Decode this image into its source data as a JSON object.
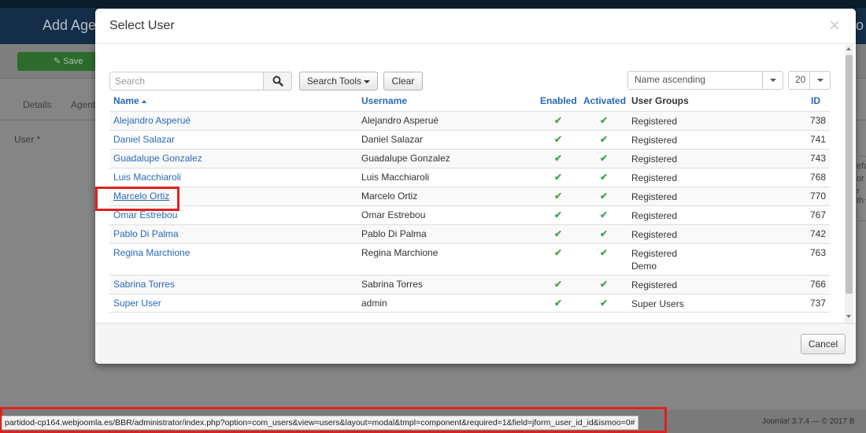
{
  "background": {
    "page_title": "Add Age",
    "page_title_right": "o",
    "save_label": "Save",
    "tabs": [
      "Details",
      "Agent"
    ],
    "user_label": "User *",
    "side_fragments": [
      "efa",
      "or",
      "r th"
    ],
    "footer_text": "Joomla! 3.7.4 — © 2017 B"
  },
  "modal": {
    "title": "Select User",
    "close_glyph": "×",
    "search": {
      "placeholder": "Search",
      "value": ""
    },
    "search_tools_label": "Search Tools",
    "clear_label": "Clear",
    "sort_select": "Name ascending",
    "limit_select": "20",
    "columns": {
      "name": "Name",
      "username": "Username",
      "enabled": "Enabled",
      "activated": "Activated",
      "groups": "User Groups",
      "id": "ID"
    },
    "rows": [
      {
        "name": "Alejandro Asperué",
        "username": "Alejandro Asperué",
        "enabled": "✔",
        "activated": "✔",
        "groups": "Registered",
        "id": "738"
      },
      {
        "name": "Daniel Salazar",
        "username": "Daniel Salazar",
        "enabled": "✔",
        "activated": "✔",
        "groups": "Registered",
        "id": "741"
      },
      {
        "name": "Guadalupe Gonzalez",
        "username": "Guadalupe Gonzalez",
        "enabled": "✔",
        "activated": "✔",
        "groups": "Registered",
        "id": "743"
      },
      {
        "name": "Luis Macchiaroli",
        "username": "Luis Macchiaroli",
        "enabled": "✔",
        "activated": "✔",
        "groups": "Registered",
        "id": "768"
      },
      {
        "name": "Marcelo Ortiz",
        "username": "Marcelo Ortiz",
        "enabled": "✔",
        "activated": "✔",
        "groups": "Registered",
        "id": "770"
      },
      {
        "name": "Omar Estrebou",
        "username": "Omar Estrebou",
        "enabled": "✔",
        "activated": "✔",
        "groups": "Registered",
        "id": "767"
      },
      {
        "name": "Pablo Di Palma",
        "username": "Pablo Di Palma",
        "enabled": "✔",
        "activated": "✔",
        "groups": "Registered",
        "id": "742"
      },
      {
        "name": "Regina Marchione",
        "username": "Regina Marchione",
        "enabled": "✔",
        "activated": "✔",
        "groups": "Registered",
        "groups2": "Demo",
        "id": "763"
      },
      {
        "name": "Sabrina Torres",
        "username": "Sabrina Torres",
        "enabled": "✔",
        "activated": "✔",
        "groups": "Registered",
        "id": "766"
      },
      {
        "name": "Super User",
        "username": "admin",
        "enabled": "✔",
        "activated": "✔",
        "groups": "Super Users",
        "id": "737"
      }
    ],
    "cancel_label": "Cancel"
  },
  "status_bar": {
    "url": "partidod-cp164.webjoomla.es/BBR/administrator/index.php?option=com_users&view=users&layout=modal&tmpl=component&required=1&field=jform_user_id_id&ismoo=0#"
  },
  "colors": {
    "link": "#2a69b8",
    "check_green": "#46a546",
    "annotation_red": "#e0201f"
  },
  "icons": [
    "search-icon",
    "close-icon",
    "check-icon",
    "caret-down-icon",
    "sort-asc-icon"
  ]
}
